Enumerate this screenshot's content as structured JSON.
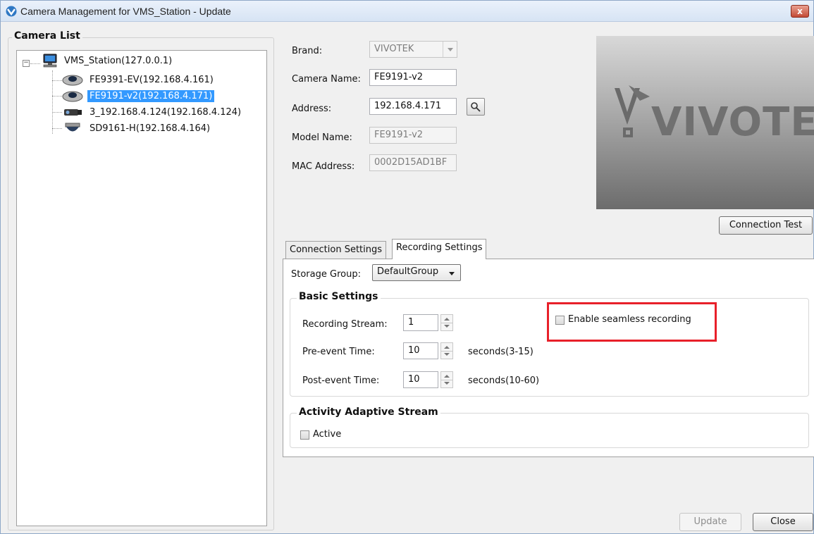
{
  "window": {
    "title": "Camera Management for VMS_Station - Update",
    "close_glyph": "x"
  },
  "camera_list": {
    "group_label": "Camera List",
    "root": "VMS_Station(127.0.0.1)",
    "cameras": [
      "FE9391-EV(192.168.4.161)",
      "FE9191-v2(192.168.4.171)",
      "3_192.168.4.124(192.168.4.124)",
      "SD9161-H(192.168.4.164)"
    ],
    "selected_index": 1
  },
  "form": {
    "brand_label": "Brand:",
    "brand_value": "VIVOTEK",
    "camera_name_label": "Camera Name:",
    "camera_name_value": "FE9191-v2",
    "address_label": "Address:",
    "address_value": "192.168.4.171",
    "model_label": "Model Name:",
    "model_value": "FE9191-v2",
    "mac_label": "MAC Address:",
    "mac_value": "0002D15AD1BF"
  },
  "preview": {
    "logo": "VIVOTEK"
  },
  "buttons": {
    "connection_test": "Connection Test",
    "update": "Update",
    "close": "Close"
  },
  "tabs": [
    {
      "label": "Connection Settings",
      "active": false
    },
    {
      "label": "Recording Settings",
      "active": true
    }
  ],
  "recording": {
    "storage_group_label": "Storage Group:",
    "storage_group_value": "DefaultGroup",
    "basic_settings_title": "Basic Settings",
    "recording_stream_label": "Recording Stream:",
    "recording_stream_value": "1",
    "pre_event_label": "Pre-event Time:",
    "pre_event_value": "10",
    "pre_event_unit": "seconds(3-15)",
    "post_event_label": "Post-event Time:",
    "post_event_value": "10",
    "post_event_unit": "seconds(10-60)",
    "seamless_label": "Enable seamless recording",
    "seamless_checked": false,
    "activity_title": "Activity Adaptive Stream",
    "active_label": "Active",
    "active_checked": false
  },
  "colors": {
    "selection": "#3399ff",
    "highlight_box": "#e8202a"
  }
}
